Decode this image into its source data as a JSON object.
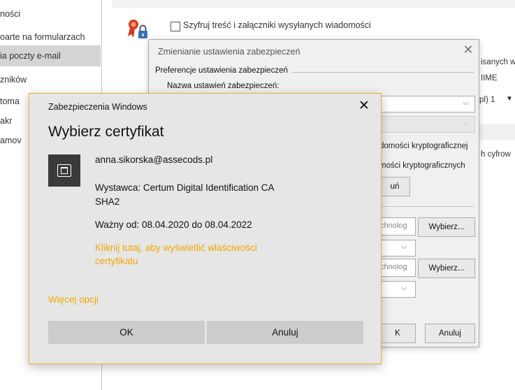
{
  "sidebar": {
    "items": [
      {
        "label": "ności"
      },
      {
        "label": "oarte na formularzach"
      },
      {
        "label": "ia poczty e-mail",
        "selected": true
      },
      {
        "label": "zników"
      },
      {
        "label": "toma"
      },
      {
        "label": "akr"
      },
      {
        "label": "amov"
      }
    ]
  },
  "main": {
    "encrypt_label": "Szyfruj treść i załączniki wysyłanych wiadomości",
    "right_fragments": {
      "line1": "isanych w",
      "line2": "IIME",
      "combo_value": "pl) 1",
      "line3": "h cyfrow"
    }
  },
  "security_dialog": {
    "title": "Zmienianie ustawienia zabezpieczeń",
    "group_label": "Preferencje ustawienia zabezpieczeń",
    "name_label": "Nazwa ustawień zabezpieczeń:",
    "crypto_text1": "domości kryptograficznej",
    "crypto_text2": "mości kryptograficznych",
    "partial_button": "uń",
    "tech_value1": "chnolog",
    "tech_value2": "chnolog",
    "choose_label": "Wybierz...",
    "ok_fragment": "K",
    "cancel_label": "Anuluj"
  },
  "windows_dialog": {
    "title": "Zabezpieczenia Windows",
    "heading": "Wybierz certyfikat",
    "email": "anna.sikorska@assecods.pl",
    "issuer_line1": "Wystawca: Certum Digital Identification CA",
    "issuer_line2": "SHA2",
    "validity": "Ważny od: 08.04.2020 do 08.04.2022",
    "link": "Kliknij tutaj, aby wyświetlić właściwości certyfikatu",
    "more_options": "Więcej opcji",
    "ok_label": "OK",
    "cancel_label": "Anuluj",
    "accent_color": "#f0a800"
  }
}
